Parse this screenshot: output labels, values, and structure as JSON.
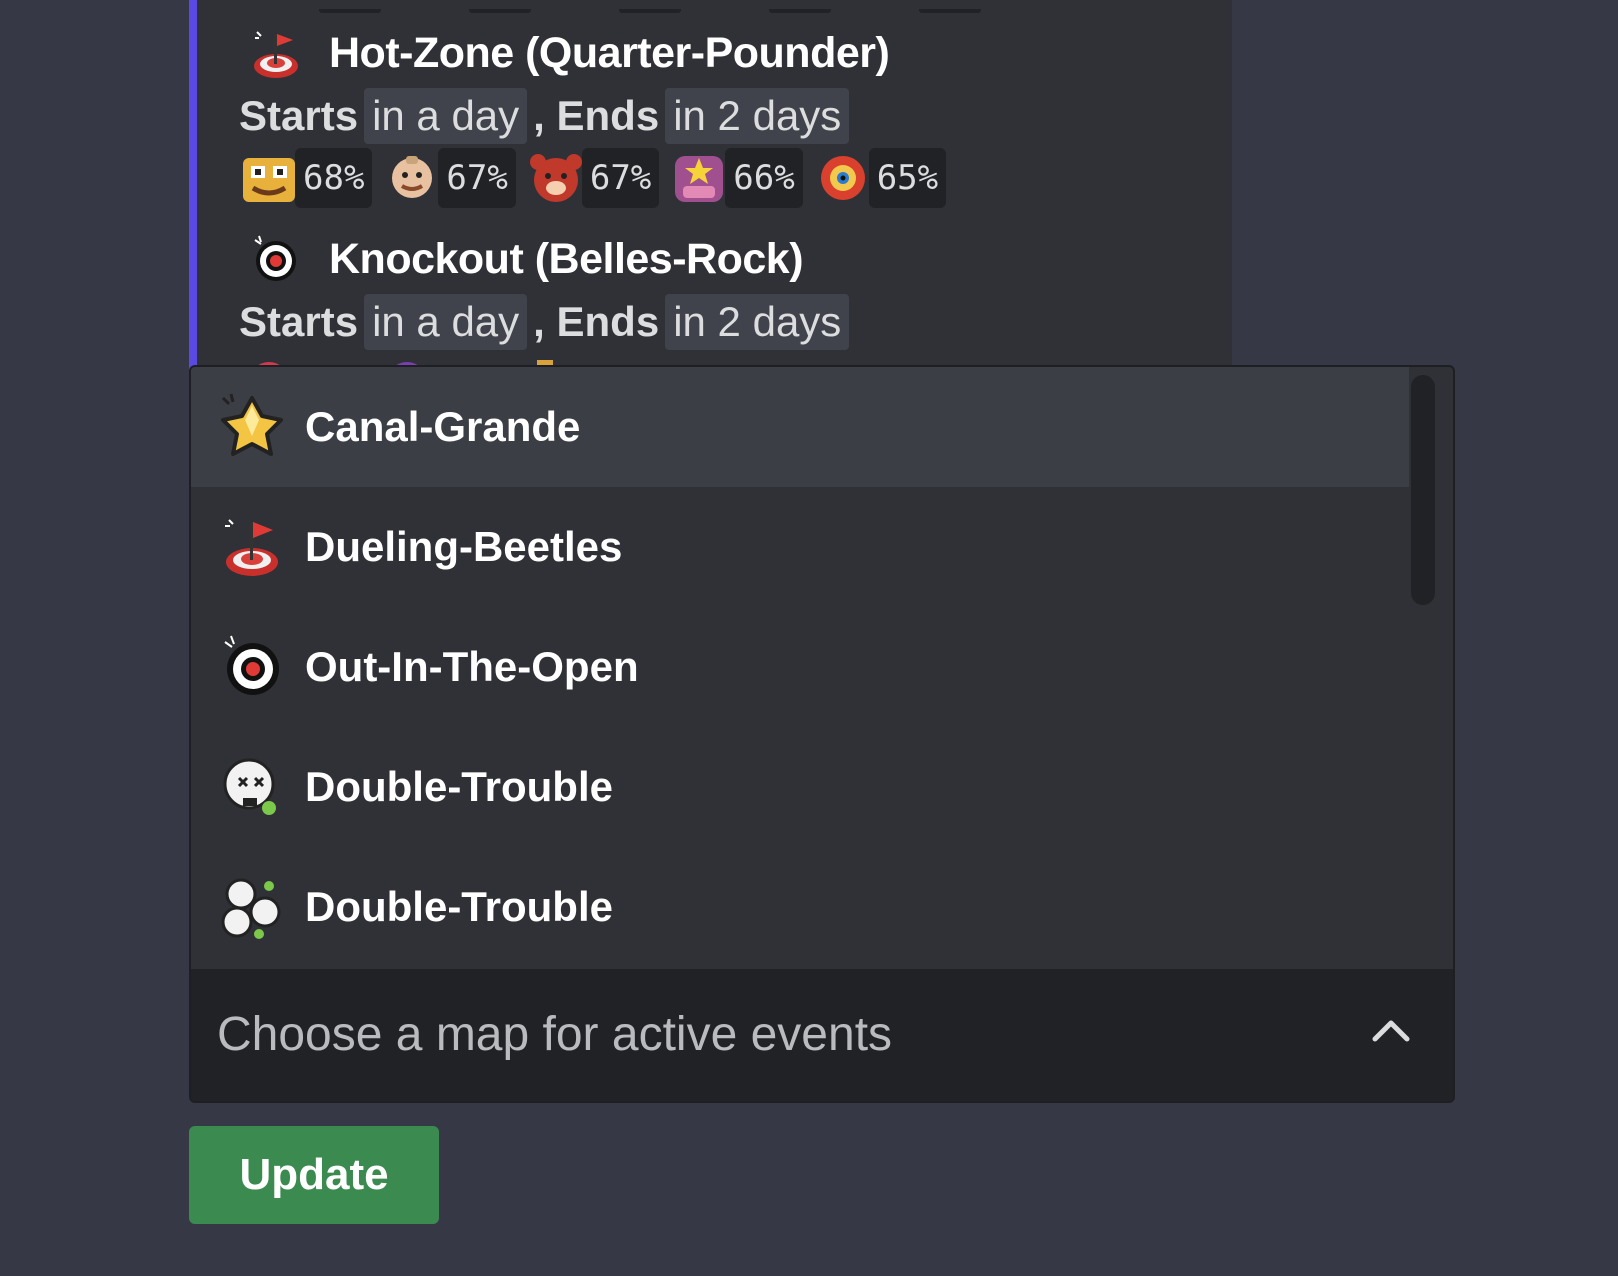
{
  "events": [
    {
      "mode_icon": "hot-zone-icon",
      "title": "Hot-Zone (Quarter-Pounder)",
      "starts_label": "Starts",
      "starts_value": "in a day",
      "comma": ",",
      "ends_label": "Ends",
      "ends_value": "in 2 days",
      "brawlers": [
        {
          "icon": "brawler-icon-1",
          "pct": "68%"
        },
        {
          "icon": "brawler-icon-2",
          "pct": "67%"
        },
        {
          "icon": "brawler-icon-3",
          "pct": "67%"
        },
        {
          "icon": "brawler-icon-4",
          "pct": "66%"
        },
        {
          "icon": "brawler-icon-5",
          "pct": "65%"
        }
      ]
    },
    {
      "mode_icon": "knockout-icon",
      "title": "Knockout (Belles-Rock)",
      "starts_label": "Starts",
      "starts_value": "in a day",
      "comma": ",",
      "ends_label": "Ends",
      "ends_value": "in 2 days"
    }
  ],
  "dropdown": {
    "options": [
      {
        "icon": "gem-grab-icon",
        "label": "Canal-Grande",
        "highlighted": true
      },
      {
        "icon": "hot-zone-icon",
        "label": "Dueling-Beetles"
      },
      {
        "icon": "knockout-icon",
        "label": "Out-In-The-Open"
      },
      {
        "icon": "solo-showdown-icon",
        "label": "Double-Trouble"
      },
      {
        "icon": "duo-showdown-icon",
        "label": "Double-Trouble"
      }
    ],
    "placeholder": "Choose a map for active events",
    "chevron_icon": "chevron-up-icon"
  },
  "update_button": "Update",
  "colors": {
    "background": "#363945",
    "embed": "#2f3136",
    "accent_bar": "#5a4ae3",
    "button": "#3b8a4f"
  }
}
